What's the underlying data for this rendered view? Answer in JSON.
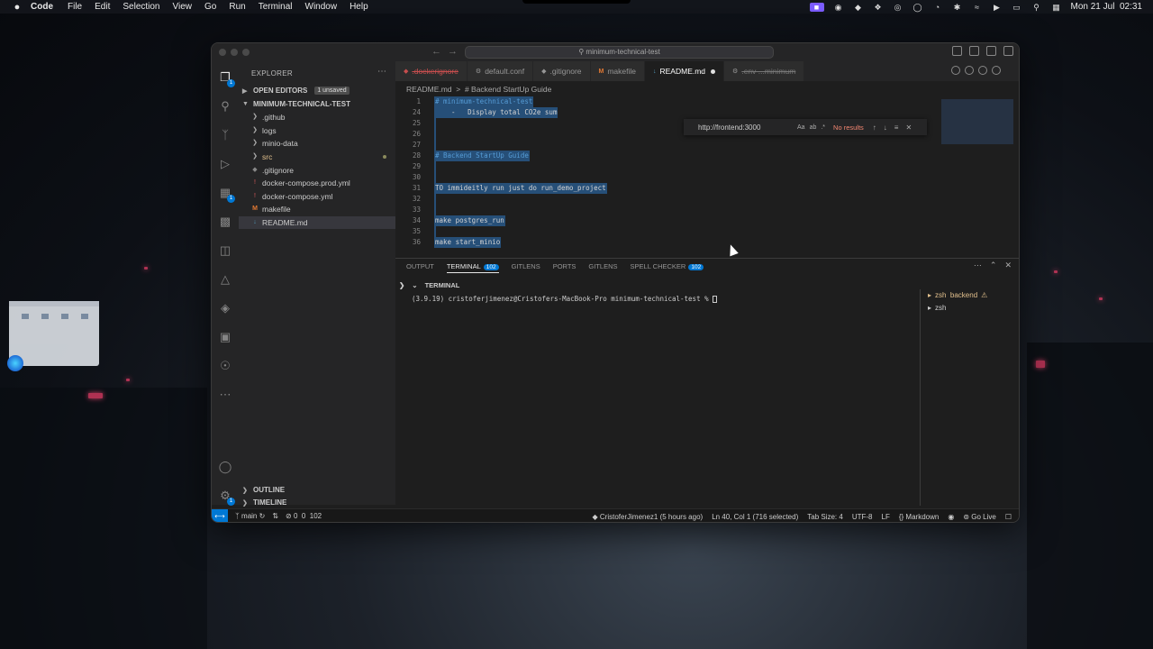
{
  "menubar": {
    "app": "Code",
    "items": [
      "File",
      "Edit",
      "Selection",
      "View",
      "Go",
      "Run",
      "Terminal",
      "Window",
      "Help"
    ],
    "datetime": "Mon 21 Jul  02:31"
  },
  "window": {
    "search_text": "minimum-technical-test"
  },
  "sidebar": {
    "title": "EXPLORER",
    "open_editors": "OPEN EDITORS",
    "unsaved_badge": "1 unsaved",
    "project": "MINIMUM-TECHNICAL-TEST",
    "tree": [
      {
        "label": ".github",
        "type": "folder"
      },
      {
        "label": "logs",
        "type": "folder"
      },
      {
        "label": "minio-data",
        "type": "folder"
      },
      {
        "label": "src",
        "type": "folder"
      },
      {
        "label": ".gitignore",
        "type": "file"
      },
      {
        "label": "docker-compose.prod.yml",
        "type": "file"
      },
      {
        "label": "docker-compose.yml",
        "type": "file"
      },
      {
        "label": "makefile",
        "type": "file"
      },
      {
        "label": "README.md",
        "type": "file"
      }
    ],
    "outline": "OUTLINE",
    "timeline": "TIMELINE"
  },
  "tabs": [
    {
      "label": ".dockerignore"
    },
    {
      "label": "default.conf"
    },
    {
      "label": ".gitignore"
    },
    {
      "label": "makefile"
    },
    {
      "label": "README.md"
    },
    {
      "label": ".env ...minimum"
    }
  ],
  "breadcrumb": "README.md  >  # Backend StartUp Guide",
  "code": [
    {
      "n": "1",
      "text": "# minimum-technical-test"
    },
    {
      "n": "24",
      "text": "    -   Display total CO2e sum"
    },
    {
      "n": "25",
      "text": ""
    },
    {
      "n": "26",
      "text": ""
    },
    {
      "n": "27",
      "text": ""
    },
    {
      "n": "28",
      "text": "# Backend StartUp Guide"
    },
    {
      "n": "29",
      "text": ""
    },
    {
      "n": "30",
      "text": ""
    },
    {
      "n": "31",
      "text": "TO immideitly run just do run_demo_project"
    },
    {
      "n": "32",
      "text": ""
    },
    {
      "n": "33",
      "text": ""
    },
    {
      "n": "34",
      "text": "make postgres_run"
    },
    {
      "n": "35",
      "text": ""
    },
    {
      "n": "36",
      "text": "make start_minio"
    }
  ],
  "find": {
    "value": "http://frontend:3000",
    "opt_case": "Aa",
    "result": "No results"
  },
  "panel": {
    "tabs": [
      {
        "label": "OUTPUT",
        "badge": ""
      },
      {
        "label": "TERMINAL",
        "badge": "102"
      },
      {
        "label": "GITLENS",
        "badge": ""
      },
      {
        "label": "PORTS",
        "badge": ""
      },
      {
        "label": "GITLENS",
        "badge": ""
      },
      {
        "label": "SPELL CHECKER",
        "badge": "102"
      }
    ],
    "terminal_header": "TERMINAL",
    "prompt": "(3.9.19) cristoferjimenez@Cristofers-MacBook-Pro minimum-technical-test % ",
    "terminals": [
      {
        "label": "zsh  backend"
      },
      {
        "label": "zsh"
      }
    ]
  },
  "statusbar": {
    "branch": "main",
    "problems": "0  0  102",
    "blame": "CristoferJimenez1 (5 hours ago)",
    "position": "Ln 40, Col 1 (716 selected)",
    "tab_size": "Tab Size: 4",
    "encoding": "UTF-8",
    "eol": "LF",
    "language": "Markdown",
    "go_live": "Go Live"
  }
}
